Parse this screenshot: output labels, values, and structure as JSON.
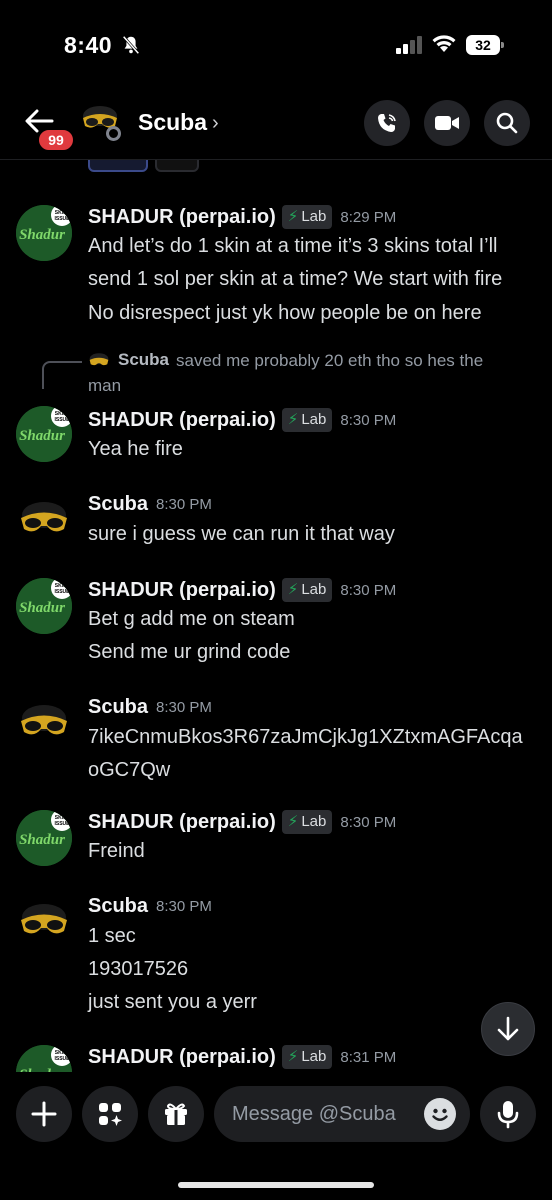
{
  "status_bar": {
    "time": "8:40",
    "battery": "32"
  },
  "header": {
    "back_badge": "99",
    "title": "Scuba",
    "chevron": "›"
  },
  "messages": [
    {
      "author": "SHADUR (perpai.io)",
      "tag": "Lab",
      "time": "8:29 PM",
      "lines": [
        "And let’s do 1 skin at a time it’s 3 skins total I’ll",
        "send 1 sol per skin at a time? We start with fire",
        "No disrespect just yk how people be on here"
      ]
    },
    {
      "reply": {
        "name": "Scuba",
        "text_line1": "saved me probably 20 eth tho so hes the",
        "text_line2": "man"
      },
      "author": "SHADUR (perpai.io)",
      "tag": "Lab",
      "time": "8:30 PM",
      "lines": [
        "Yea he fire"
      ]
    },
    {
      "author": "Scuba",
      "time": "8:30 PM",
      "lines": [
        "sure i guess we can run it that way"
      ]
    },
    {
      "author": "SHADUR (perpai.io)",
      "tag": "Lab",
      "time": "8:30 PM",
      "lines": [
        "Bet g add me on steam",
        "Send me ur grind code"
      ]
    },
    {
      "author": "Scuba",
      "time": "8:30 PM",
      "lines": [
        "7ikeCnmuBkos3R67zaJmCjkJg1XZtxmAGFAcqa",
        "oGC7Qw"
      ]
    },
    {
      "author": "SHADUR (perpai.io)",
      "tag": "Lab",
      "time": "8:30 PM",
      "lines": [
        "Freind"
      ]
    },
    {
      "author": "Scuba",
      "time": "8:30 PM",
      "lines": [
        "1 sec",
        "193017526",
        "just sent you a yerr"
      ]
    },
    {
      "author": "SHADUR (perpai.io)",
      "tag": "Lab",
      "time": "8:31 PM",
      "lines": []
    }
  ],
  "avatar_text": {
    "shadur": "Shadur",
    "badge": "SKILL ISSUE"
  },
  "composer": {
    "placeholder": "Message @Scuba"
  },
  "colors": {
    "accent_green": "#23a55a",
    "badge_red": "#e03a3e",
    "background": "#000000"
  }
}
